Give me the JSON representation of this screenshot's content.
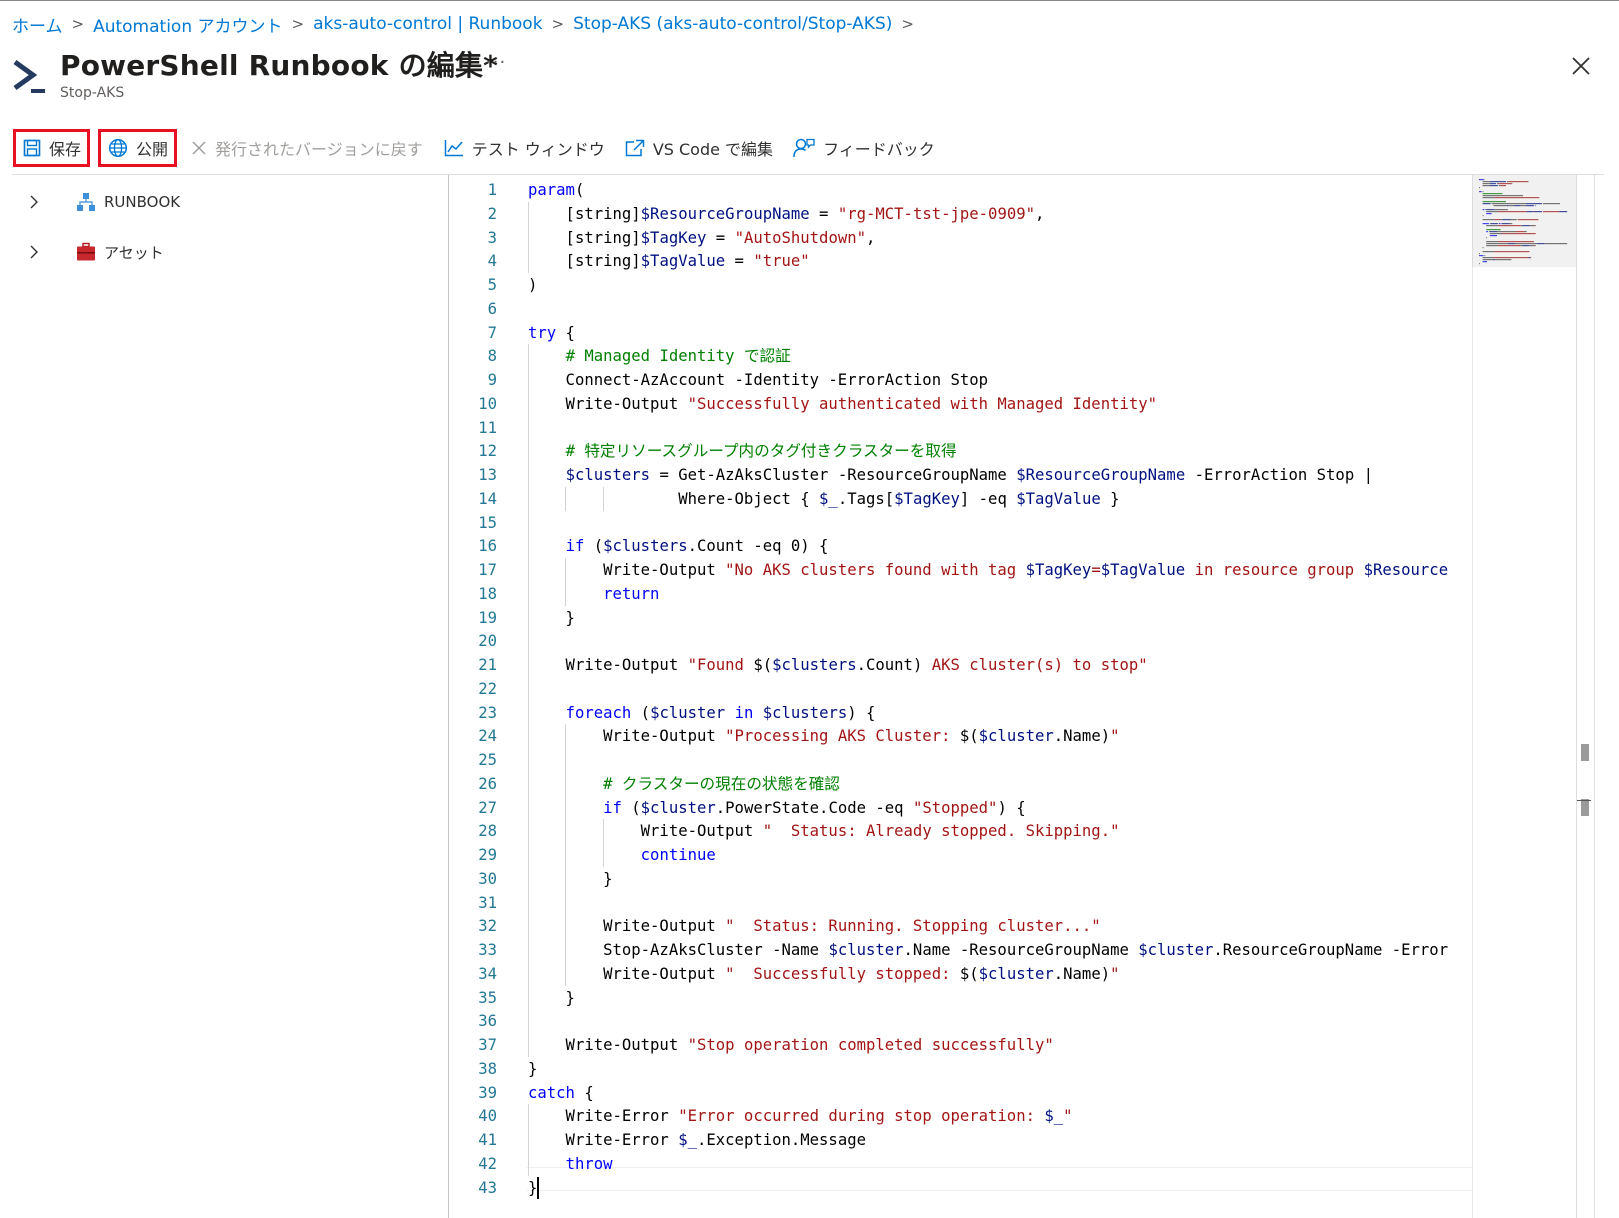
{
  "breadcrumb": {
    "items": [
      "ホーム",
      "Automation アカウント",
      "aks-auto-control | Runbook",
      "Stop-AKS (aks-auto-control/Stop-AKS)"
    ]
  },
  "header": {
    "title": "PowerShell Runbook の編集*",
    "subtitle": "Stop-AKS",
    "more": "···"
  },
  "toolbar": {
    "save": "保存",
    "publish": "公開",
    "revert": "発行されたバージョンに戻す",
    "test_window": "テスト ウィンドウ",
    "vscode": "VS Code で編集",
    "feedback": "フィードバック"
  },
  "tree": {
    "runbook": "RUNBOOK",
    "assets": "アセット"
  },
  "code": {
    "line_numbers": [
      "1",
      "2",
      "3",
      "4",
      "5",
      "6",
      "7",
      "8",
      "9",
      "10",
      "11",
      "12",
      "13",
      "14",
      "15",
      "16",
      "17",
      "18",
      "19",
      "20",
      "21",
      "22",
      "23",
      "24",
      "25",
      "26",
      "27",
      "28",
      "29",
      "30",
      "31",
      "32",
      "33",
      "34",
      "35",
      "36",
      "37",
      "38",
      "39",
      "40",
      "41",
      "42",
      "43"
    ],
    "lines": [
      [
        {
          "t": "param",
          "c": "kw"
        },
        {
          "t": "(",
          "c": ""
        }
      ],
      [
        {
          "t": "    [string]",
          "c": ""
        },
        {
          "t": "$ResourceGroupName",
          "c": "var"
        },
        {
          "t": " = ",
          "c": ""
        },
        {
          "t": "\"rg-MCT-tst-jpe-0909\"",
          "c": "str"
        },
        {
          "t": ",",
          "c": ""
        }
      ],
      [
        {
          "t": "    [string]",
          "c": ""
        },
        {
          "t": "$TagKey",
          "c": "var"
        },
        {
          "t": " = ",
          "c": ""
        },
        {
          "t": "\"AutoShutdown\"",
          "c": "str"
        },
        {
          "t": ",",
          "c": ""
        }
      ],
      [
        {
          "t": "    [string]",
          "c": ""
        },
        {
          "t": "$TagValue",
          "c": "var"
        },
        {
          "t": " = ",
          "c": ""
        },
        {
          "t": "\"true\"",
          "c": "str"
        }
      ],
      [
        {
          "t": ")",
          "c": ""
        }
      ],
      [],
      [
        {
          "t": "try",
          "c": "kw"
        },
        {
          "t": " {",
          "c": ""
        }
      ],
      [
        {
          "t": "    ",
          "c": ""
        },
        {
          "t": "# Managed Identity で認証",
          "c": "cm"
        }
      ],
      [
        {
          "t": "    Connect-AzAccount -Identity -ErrorAction Stop",
          "c": ""
        }
      ],
      [
        {
          "t": "    Write-Output ",
          "c": ""
        },
        {
          "t": "\"Successfully authenticated with Managed Identity\"",
          "c": "str"
        }
      ],
      [],
      [
        {
          "t": "    ",
          "c": ""
        },
        {
          "t": "# 特定リソースグループ内のタグ付きクラスターを取得",
          "c": "cm"
        }
      ],
      [
        {
          "t": "    ",
          "c": ""
        },
        {
          "t": "$clusters",
          "c": "var"
        },
        {
          "t": " = Get-AzAksCluster -ResourceGroupName ",
          "c": ""
        },
        {
          "t": "$ResourceGroupName",
          "c": "var"
        },
        {
          "t": " -ErrorAction Stop |",
          "c": ""
        }
      ],
      [
        {
          "t": "                Where-Object { ",
          "c": ""
        },
        {
          "t": "$_",
          "c": "var"
        },
        {
          "t": ".Tags[",
          "c": ""
        },
        {
          "t": "$TagKey",
          "c": "var"
        },
        {
          "t": "] -eq ",
          "c": ""
        },
        {
          "t": "$TagValue",
          "c": "var"
        },
        {
          "t": " }",
          "c": ""
        }
      ],
      [],
      [
        {
          "t": "    ",
          "c": ""
        },
        {
          "t": "if",
          "c": "kw"
        },
        {
          "t": " (",
          "c": ""
        },
        {
          "t": "$clusters",
          "c": "var"
        },
        {
          "t": ".Count -eq 0) {",
          "c": ""
        }
      ],
      [
        {
          "t": "        Write-Output ",
          "c": ""
        },
        {
          "t": "\"No AKS clusters found with tag ",
          "c": "str"
        },
        {
          "t": "$TagKey",
          "c": "var"
        },
        {
          "t": "=",
          "c": "str"
        },
        {
          "t": "$TagValue",
          "c": "var"
        },
        {
          "t": " in resource group ",
          "c": "str"
        },
        {
          "t": "$Resource",
          "c": "var"
        }
      ],
      [
        {
          "t": "        ",
          "c": ""
        },
        {
          "t": "return",
          "c": "kw"
        }
      ],
      [
        {
          "t": "    }",
          "c": ""
        }
      ],
      [],
      [
        {
          "t": "    Write-Output ",
          "c": ""
        },
        {
          "t": "\"Found ",
          "c": "str"
        },
        {
          "t": "$(",
          "c": ""
        },
        {
          "t": "$clusters",
          "c": "var"
        },
        {
          "t": ".Count)",
          "c": ""
        },
        {
          "t": " AKS cluster(s) to stop\"",
          "c": "str"
        }
      ],
      [],
      [
        {
          "t": "    ",
          "c": ""
        },
        {
          "t": "foreach",
          "c": "kw"
        },
        {
          "t": " (",
          "c": ""
        },
        {
          "t": "$cluster",
          "c": "var"
        },
        {
          "t": " ",
          "c": ""
        },
        {
          "t": "in",
          "c": "kw"
        },
        {
          "t": " ",
          "c": ""
        },
        {
          "t": "$clusters",
          "c": "var"
        },
        {
          "t": ") {",
          "c": ""
        }
      ],
      [
        {
          "t": "        Write-Output ",
          "c": ""
        },
        {
          "t": "\"Processing AKS Cluster: ",
          "c": "str"
        },
        {
          "t": "$(",
          "c": ""
        },
        {
          "t": "$cluster",
          "c": "var"
        },
        {
          "t": ".Name)",
          "c": ""
        },
        {
          "t": "\"",
          "c": "str"
        }
      ],
      [],
      [
        {
          "t": "        ",
          "c": ""
        },
        {
          "t": "# クラスターの現在の状態を確認",
          "c": "cm"
        }
      ],
      [
        {
          "t": "        ",
          "c": ""
        },
        {
          "t": "if",
          "c": "kw"
        },
        {
          "t": " (",
          "c": ""
        },
        {
          "t": "$cluster",
          "c": "var"
        },
        {
          "t": ".PowerState.Code -eq ",
          "c": ""
        },
        {
          "t": "\"Stopped\"",
          "c": "str"
        },
        {
          "t": ") {",
          "c": ""
        }
      ],
      [
        {
          "t": "            Write-Output ",
          "c": ""
        },
        {
          "t": "\"  Status: Already stopped. Skipping.\"",
          "c": "str"
        }
      ],
      [
        {
          "t": "            ",
          "c": ""
        },
        {
          "t": "continue",
          "c": "kw"
        }
      ],
      [
        {
          "t": "        }",
          "c": ""
        }
      ],
      [],
      [
        {
          "t": "        Write-Output ",
          "c": ""
        },
        {
          "t": "\"  Status: Running. Stopping cluster...\"",
          "c": "str"
        }
      ],
      [
        {
          "t": "        Stop-AzAksCluster -Name ",
          "c": ""
        },
        {
          "t": "$cluster",
          "c": "var"
        },
        {
          "t": ".Name -ResourceGroupName ",
          "c": ""
        },
        {
          "t": "$cluster",
          "c": "var"
        },
        {
          "t": ".ResourceGroupName -Error",
          "c": ""
        }
      ],
      [
        {
          "t": "        Write-Output ",
          "c": ""
        },
        {
          "t": "\"  Successfully stopped: ",
          "c": "str"
        },
        {
          "t": "$(",
          "c": ""
        },
        {
          "t": "$cluster",
          "c": "var"
        },
        {
          "t": ".Name)",
          "c": ""
        },
        {
          "t": "\"",
          "c": "str"
        }
      ],
      [
        {
          "t": "    }",
          "c": ""
        }
      ],
      [],
      [
        {
          "t": "    Write-Output ",
          "c": ""
        },
        {
          "t": "\"Stop operation completed successfully\"",
          "c": "str"
        }
      ],
      [
        {
          "t": "}",
          "c": ""
        }
      ],
      [
        {
          "t": "catch",
          "c": "kw"
        },
        {
          "t": " {",
          "c": ""
        }
      ],
      [
        {
          "t": "    Write-Error ",
          "c": ""
        },
        {
          "t": "\"Error occurred during stop operation: ",
          "c": "str"
        },
        {
          "t": "$_",
          "c": "var"
        },
        {
          "t": "\"",
          "c": "str"
        }
      ],
      [
        {
          "t": "    Write-Error ",
          "c": ""
        },
        {
          "t": "$_",
          "c": "var"
        },
        {
          "t": ".Exception.Message",
          "c": ""
        }
      ],
      [
        {
          "t": "    ",
          "c": ""
        },
        {
          "t": "throw",
          "c": "kw"
        }
      ],
      [
        {
          "t": "}",
          "c": ""
        }
      ]
    ]
  },
  "colors": {
    "accent": "#0078d4",
    "highlight_box": "#e81123",
    "keyword": "#0000ff",
    "string": "#a31515",
    "comment": "#008000",
    "variable": "#001080"
  }
}
